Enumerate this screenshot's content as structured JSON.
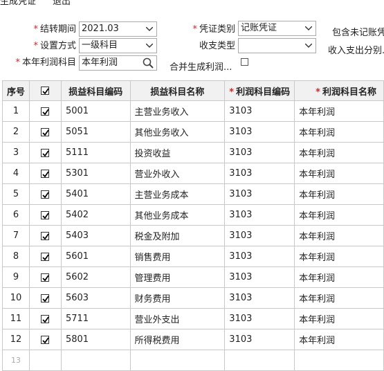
{
  "toolbar": {
    "generate_label": "生成凭证",
    "exit_label": "退出"
  },
  "form": {
    "period_label": "结转期间",
    "period_value": "2021.03",
    "voucher_type_label": "凭证类别",
    "voucher_type_value": "记账凭证",
    "include_unposted_label": "包含未记账凭",
    "setting_method_label": "设置方式",
    "setting_method_value": "一级科目",
    "income_expense_type_label": "收支类型",
    "income_expense_type_value": "",
    "split_income_expense_label": "收入支出分别...",
    "profit_account_label": "本年利润科目",
    "profit_account_value": "本年利润",
    "merge_generate_label": "合并生成利润...",
    "merge_generate_checked": false
  },
  "table": {
    "headers": {
      "seq": "序号",
      "check": "",
      "pl_code": "损益科目编码",
      "pl_name": "损益科目名称",
      "profit_code": "利润科目编码",
      "profit_name": "利润科目名称"
    },
    "rows": [
      {
        "seq": "1",
        "checked": true,
        "pl_code": "5001",
        "pl_name": "主营业务收入",
        "profit_code": "3103",
        "profit_name": "本年利润"
      },
      {
        "seq": "2",
        "checked": true,
        "pl_code": "5051",
        "pl_name": "其他业务收入",
        "profit_code": "3103",
        "profit_name": "本年利润"
      },
      {
        "seq": "3",
        "checked": true,
        "pl_code": "5111",
        "pl_name": "投资收益",
        "profit_code": "3103",
        "profit_name": "本年利润"
      },
      {
        "seq": "4",
        "checked": true,
        "pl_code": "5301",
        "pl_name": "营业外收入",
        "profit_code": "3103",
        "profit_name": "本年利润"
      },
      {
        "seq": "5",
        "checked": true,
        "pl_code": "5401",
        "pl_name": "主营业务成本",
        "profit_code": "3103",
        "profit_name": "本年利润"
      },
      {
        "seq": "6",
        "checked": true,
        "pl_code": "5402",
        "pl_name": "其他业务成本",
        "profit_code": "3103",
        "profit_name": "本年利润"
      },
      {
        "seq": "7",
        "checked": true,
        "pl_code": "5403",
        "pl_name": "税金及附加",
        "profit_code": "3103",
        "profit_name": "本年利润"
      },
      {
        "seq": "8",
        "checked": true,
        "pl_code": "5601",
        "pl_name": "销售费用",
        "profit_code": "3103",
        "profit_name": "本年利润"
      },
      {
        "seq": "9",
        "checked": true,
        "pl_code": "5602",
        "pl_name": "管理费用",
        "profit_code": "3103",
        "profit_name": "本年利润"
      },
      {
        "seq": "10",
        "checked": true,
        "pl_code": "5603",
        "pl_name": "财务费用",
        "profit_code": "3103",
        "profit_name": "本年利润"
      },
      {
        "seq": "11",
        "checked": true,
        "pl_code": "5711",
        "pl_name": "营业外支出",
        "profit_code": "3103",
        "profit_name": "本年利润"
      },
      {
        "seq": "12",
        "checked": true,
        "pl_code": "5801",
        "pl_name": "所得税费用",
        "profit_code": "3103",
        "profit_name": "本年利润"
      }
    ],
    "empty_row_seq": "13"
  },
  "colors": {
    "required": "#e02020",
    "header_bg": "#f1f1f1",
    "grid_line": "#c8c8c8"
  },
  "icons": {
    "search": "search-icon",
    "dropdown": "chevron-down-icon",
    "check": "checkmark-icon"
  }
}
